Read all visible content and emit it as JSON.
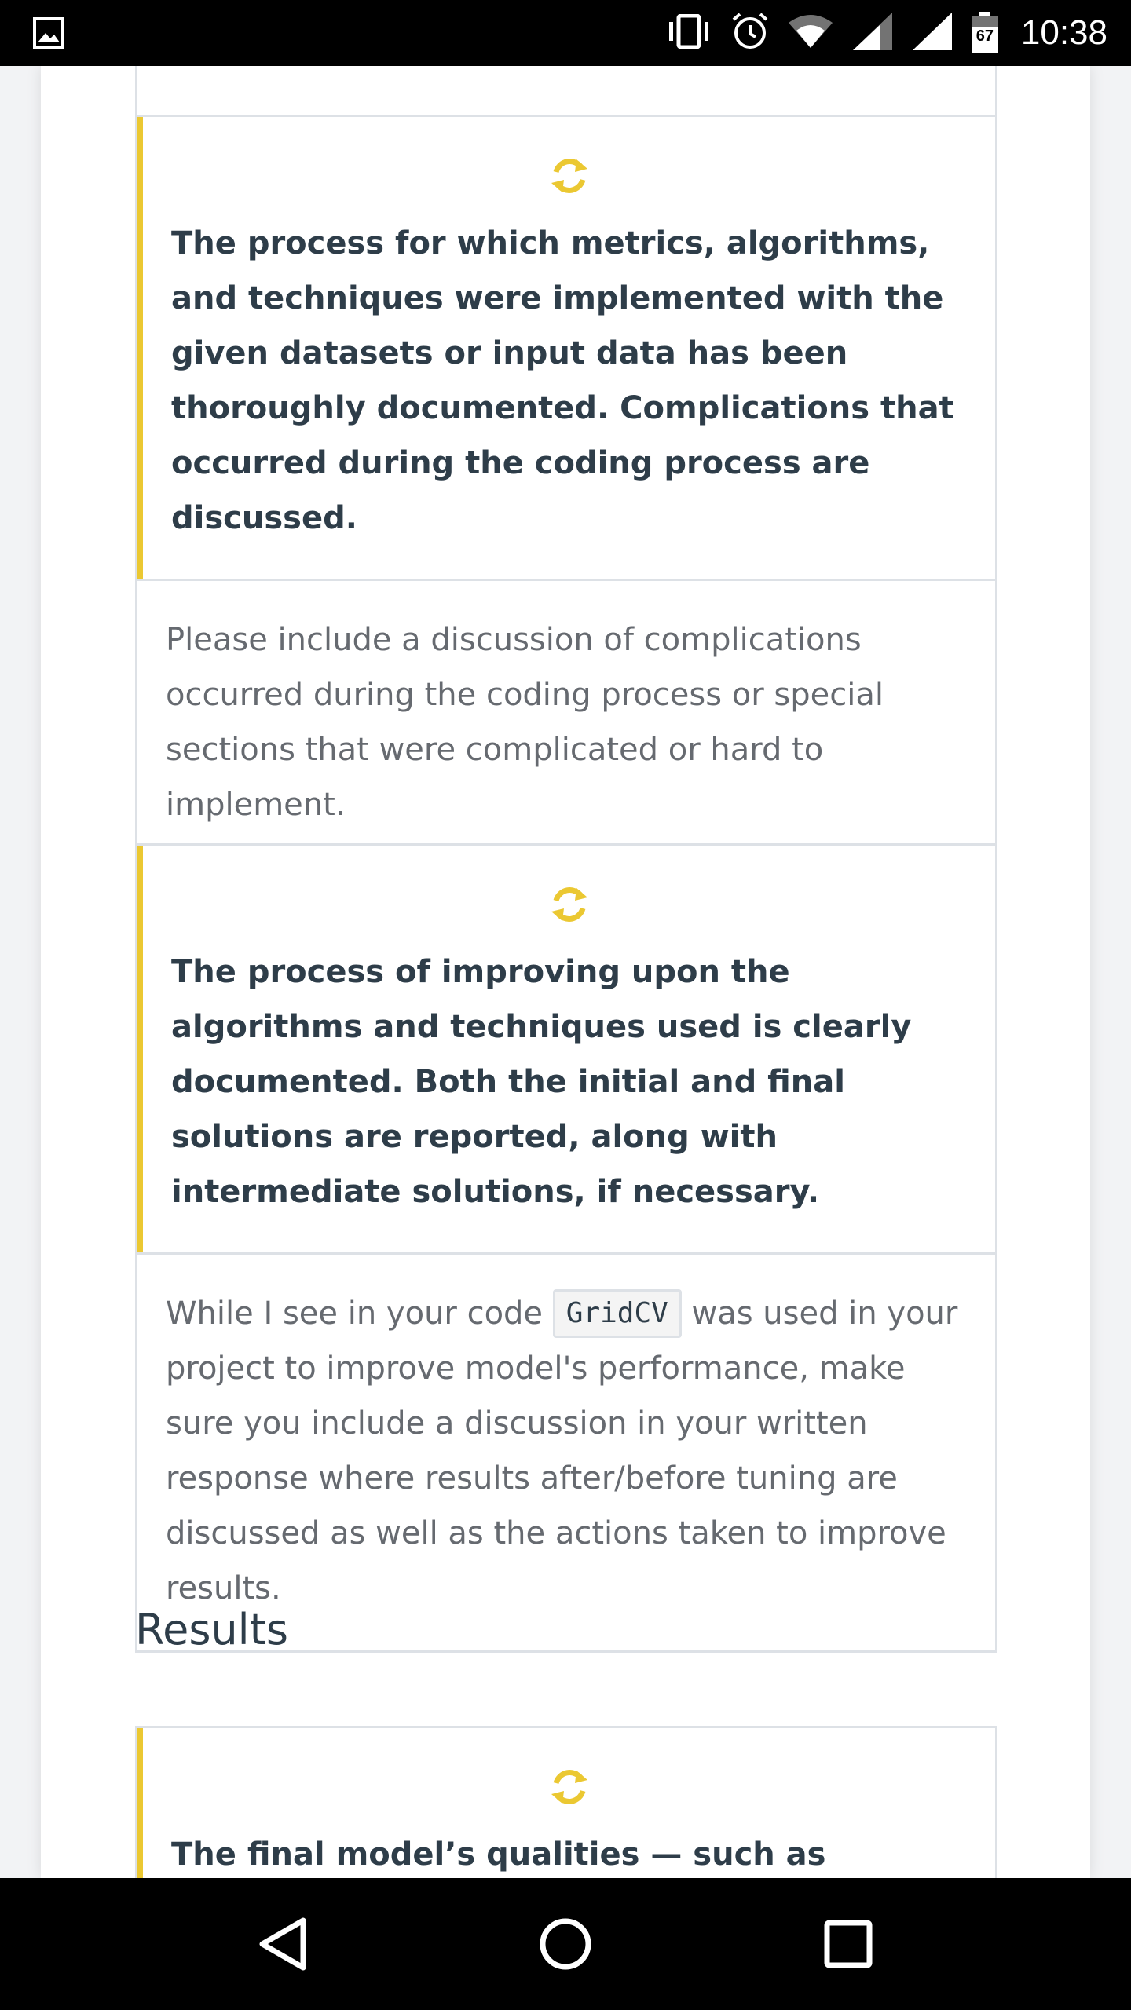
{
  "status_bar": {
    "time": "10:38",
    "battery": "67",
    "icons": [
      "image-icon",
      "vibrate-icon",
      "alarm-icon",
      "wifi-icon",
      "signal-icon",
      "signal-icon",
      "battery-icon"
    ]
  },
  "rubric_items": [
    {
      "icon": "refresh-icon",
      "criteria": "The process for which metrics, algorithms, and techniques were implemented with the given datasets or input data has been thoroughly documented. Complications that occurred during the coding process are discussed.",
      "comment": "Please include a discussion of complications occurred during the coding process or special sections that were complicated or hard to implement."
    },
    {
      "icon": "refresh-icon",
      "criteria": "The process of improving upon the algorithms and techniques used is clearly documented. Both the initial and final solutions are reported, along with intermediate solutions, if necessary.",
      "comment_before": "While I see in your code ",
      "comment_code": "GridCV",
      "comment_after": " was used in your project to improve model's performance, make sure you include a discussion in your written response where results after/before tuning are discussed as well as the actions taken to improve results."
    },
    {
      "icon": "refresh-icon",
      "criteria": "The final model’s qualities — such as parameters"
    }
  ],
  "sections": {
    "results_heading": "Results"
  },
  "colors": {
    "accent": "#ebc832",
    "heading": "#2e3d49",
    "body_text": "#666a70",
    "border": "#dde1e6"
  },
  "nav_bar": {
    "icons": [
      "back-icon",
      "home-icon",
      "recents-icon"
    ]
  }
}
